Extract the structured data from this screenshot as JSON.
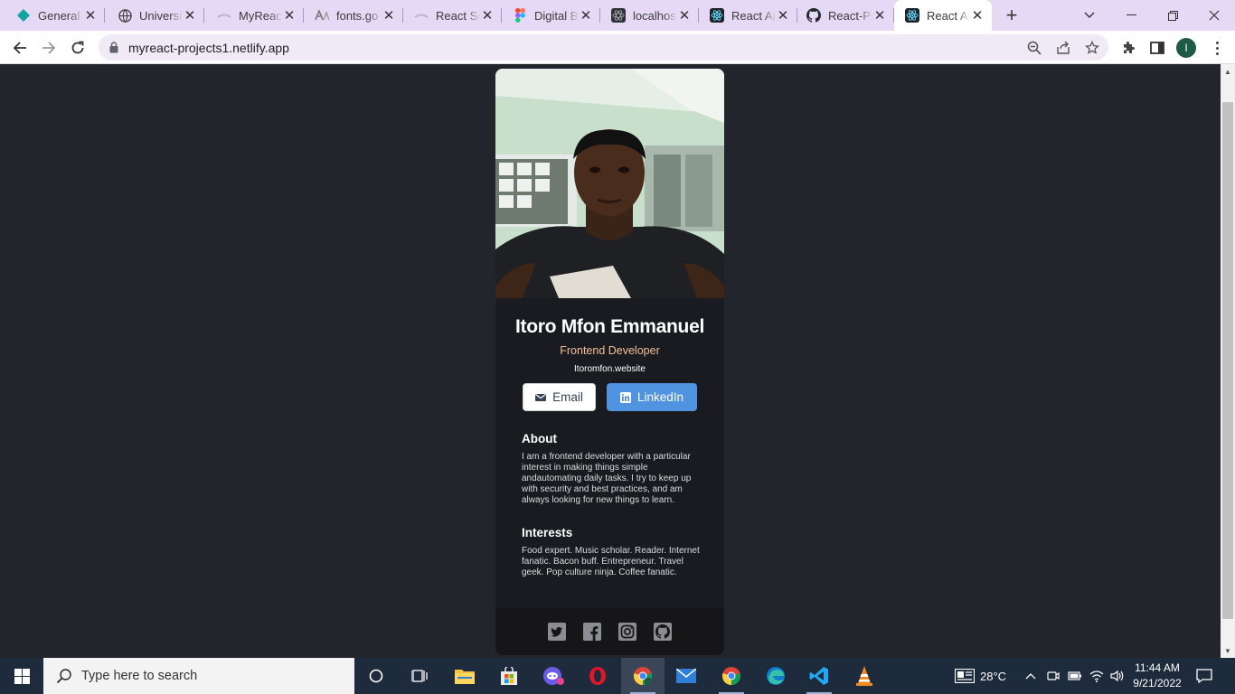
{
  "browser": {
    "tabs": [
      {
        "title": "General",
        "icon": "diamond-icon"
      },
      {
        "title": "University",
        "icon": "globe-icon"
      },
      {
        "title": "MyReact",
        "icon": "cloud-icon"
      },
      {
        "title": "fonts.go",
        "icon": "fonts-icon"
      },
      {
        "title": "React Se",
        "icon": "cloud-icon"
      },
      {
        "title": "Digital B",
        "icon": "figma-icon"
      },
      {
        "title": "localhos",
        "icon": "react-icon"
      },
      {
        "title": "React Ap",
        "icon": "react-icon"
      },
      {
        "title": "React-Pr",
        "icon": "github-icon"
      },
      {
        "title": "React Ap",
        "icon": "react-icon",
        "active": true
      }
    ],
    "url": "myreact-projects1.netlify.app",
    "profile_initial": "I"
  },
  "profile": {
    "name": "Itoro Mfon Emmanuel",
    "role": "Frontend Developer",
    "website": "Itoromfon.website",
    "email_label": "Email",
    "linkedin_label": "LinkedIn",
    "about_heading": "About",
    "about_text": "I am a frontend developer with a particular interest in making things simple andautomating daily tasks. I try to keep up with security and best practices, and am always looking for new things to learn.",
    "interests_heading": "Interests",
    "interests_text": "Food expert. Music scholar. Reader. Internet fanatic. Bacon buff. Entrepreneur. Travel geek. Pop culture ninja. Coffee fanatic.",
    "socials": [
      "twitter-icon",
      "facebook-icon",
      "instagram-icon",
      "github-icon"
    ],
    "accent_color": "#f3bf99",
    "linkedin_color": "#5093e1"
  },
  "taskbar": {
    "search_placeholder": "Type here to search",
    "temperature": "28°C",
    "time": "11:44 AM",
    "date": "9/21/2022"
  }
}
